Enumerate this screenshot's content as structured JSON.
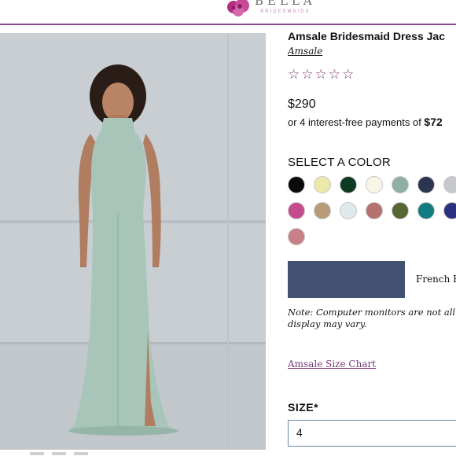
{
  "brand": {
    "name": "BELLA",
    "subtitle": "BRIDESMAIDS"
  },
  "product": {
    "title": "Amsale Bridesmaid Dress Jac",
    "designer": "Amsale",
    "rating_stars": 5,
    "price": "$290",
    "installments_prefix": "or 4 interest-free payments of ",
    "installments_amount": "$72"
  },
  "colors": {
    "heading": "SELECT A COLOR",
    "swatches": [
      "#0a0a0a",
      "#ece8a8",
      "#0f3a22",
      "#f8f6e6",
      "#8fb0a0",
      "#2c3550",
      "#c6c8cb",
      "#c44c8c",
      "#b89b78",
      "#dfe8ea",
      "#b57070",
      "#566634",
      "#137c80",
      "#2b3180",
      "#c88088"
    ],
    "selected_color_hex": "#425170",
    "selected_name": "French B",
    "note_line1": "Note: Computer monitors are not all cre",
    "note_line2": "display may vary."
  },
  "links": {
    "size_chart": "Amsale Size Chart"
  },
  "size": {
    "label": "SIZE*",
    "value": "4"
  },
  "theme": {
    "accent": "#7a3a7a",
    "dress": "#a7c6b9",
    "background_wall": "#c9ced3"
  }
}
